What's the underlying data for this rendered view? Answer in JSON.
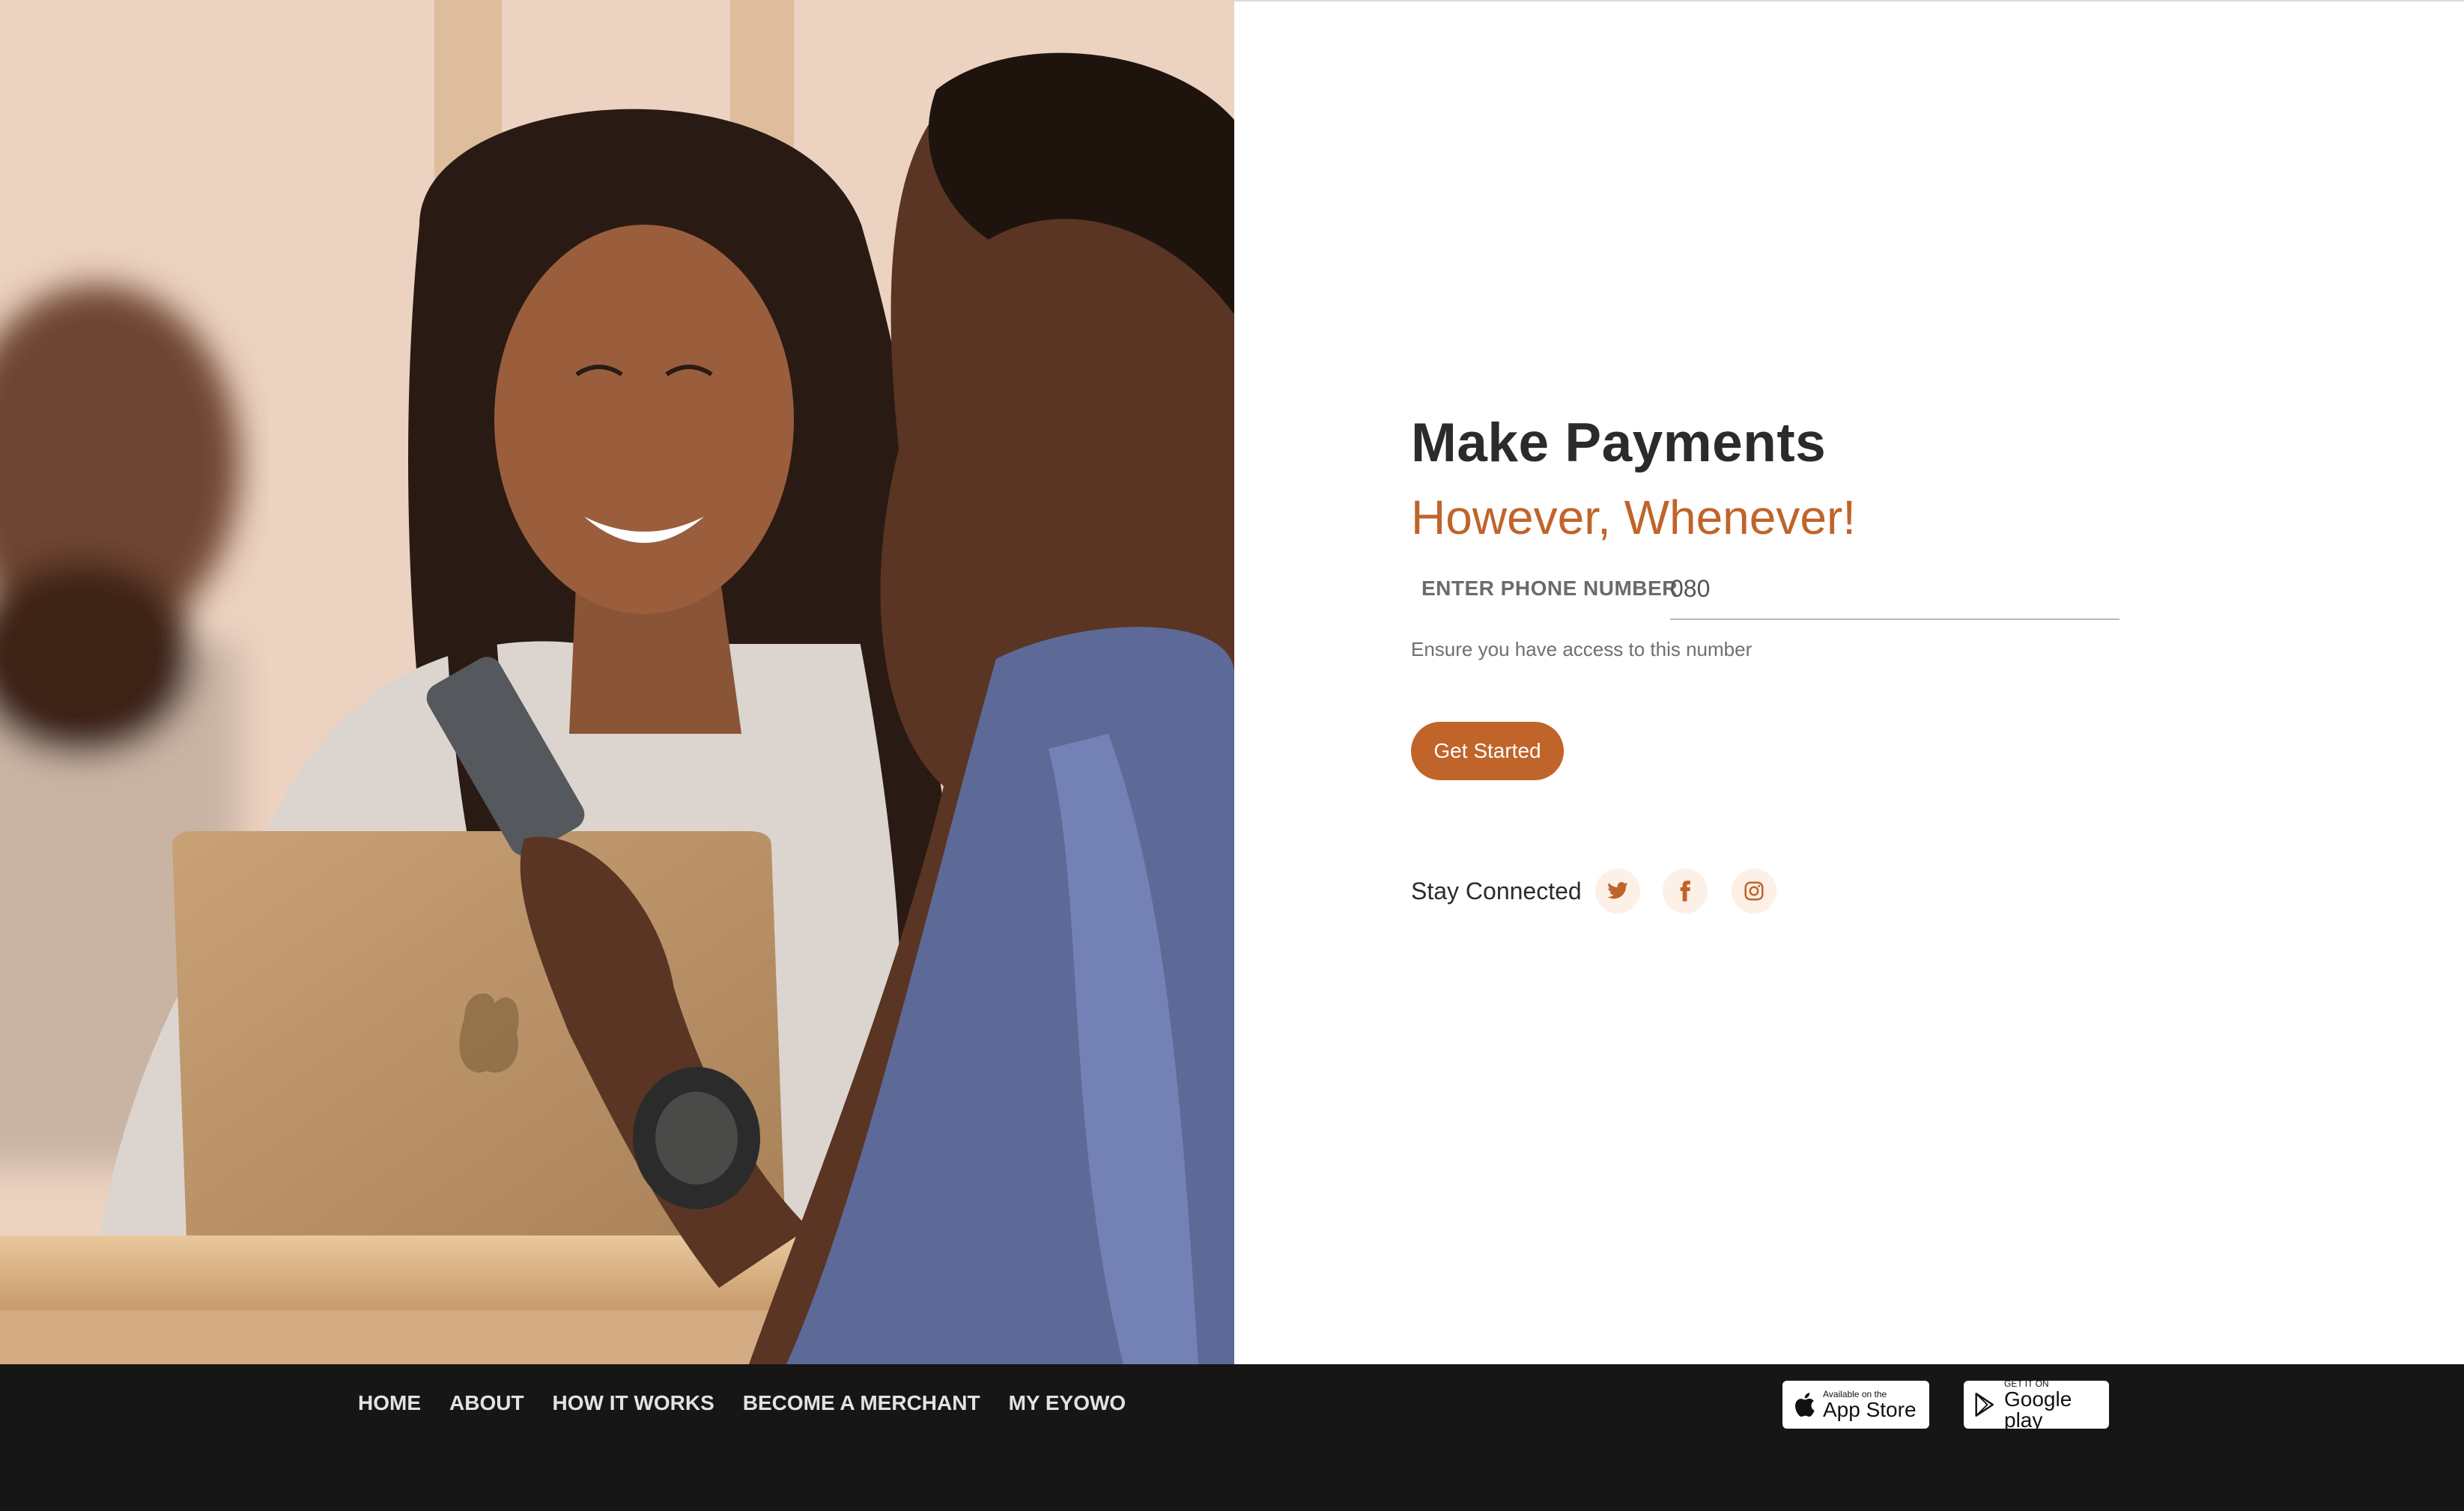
{
  "hero": {
    "image_subject": "two-people-with-laptop-and-phone"
  },
  "main": {
    "headline": "Make Payments",
    "subheadline": "However, Whenever!",
    "phone_label": "ENTER PHONE NUMBER",
    "phone_value": "080",
    "helper_text": "Ensure you have access to this number",
    "cta_label": "Get Started",
    "stay_connected": "Stay Connected",
    "social_icons": [
      "twitter-icon",
      "facebook-icon",
      "instagram-icon"
    ]
  },
  "footer": {
    "nav": [
      "HOME",
      "ABOUT",
      "HOW IT WORKS",
      "BECOME A MERCHANT",
      "MY EYOWO"
    ],
    "app_store": {
      "small": "Available on the",
      "big": "App Store"
    },
    "google_play": {
      "small": "GET IT ON",
      "big": "Google play"
    }
  },
  "colors": {
    "accent": "#c0642a",
    "heading": "#2b2b2b",
    "footer_bg": "#161616",
    "social_bg": "#fdf0e7"
  }
}
